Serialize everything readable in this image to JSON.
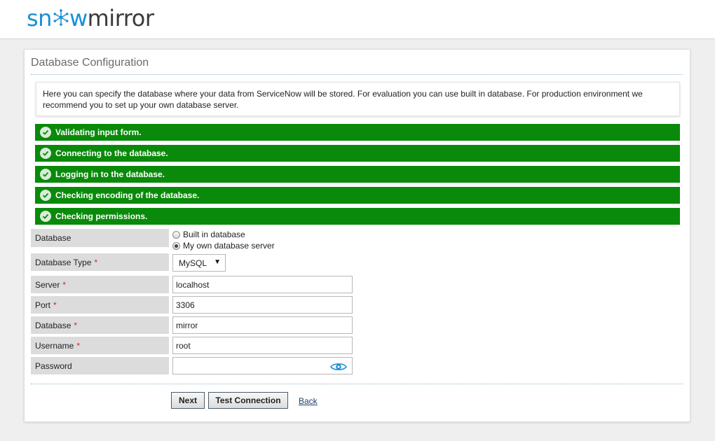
{
  "brand": {
    "logo_part1": "sn",
    "logo_part2": "w",
    "logo_part3": "mirror"
  },
  "page": {
    "title": "Database Configuration"
  },
  "info": "Here you can specify the database where your data from ServiceNow will be stored. For evaluation you can use built in database. For production environment we recommend you to set up your own database server.",
  "steps": [
    {
      "label": "Validating input form."
    },
    {
      "label": "Connecting to the database."
    },
    {
      "label": "Logging in to the database."
    },
    {
      "label": "Checking encoding of the database."
    },
    {
      "label": "Checking permissions."
    }
  ],
  "status_color": "#0a8a0a",
  "form": {
    "database_label": "Database",
    "database_options": [
      {
        "label": "Built in database",
        "selected": false
      },
      {
        "label": "My own database server",
        "selected": true
      }
    ],
    "database_type": {
      "label": "Database Type",
      "value": "MySQL"
    },
    "server": {
      "label": "Server",
      "value": "localhost"
    },
    "port": {
      "label": "Port",
      "value": "3306"
    },
    "database_name": {
      "label": "Database",
      "value": "mirror"
    },
    "username": {
      "label": "Username",
      "value": "root"
    },
    "password": {
      "label": "Password",
      "value": ""
    },
    "required_marker": "*"
  },
  "buttons": {
    "next": "Next",
    "test": "Test Connection",
    "back": "Back"
  }
}
